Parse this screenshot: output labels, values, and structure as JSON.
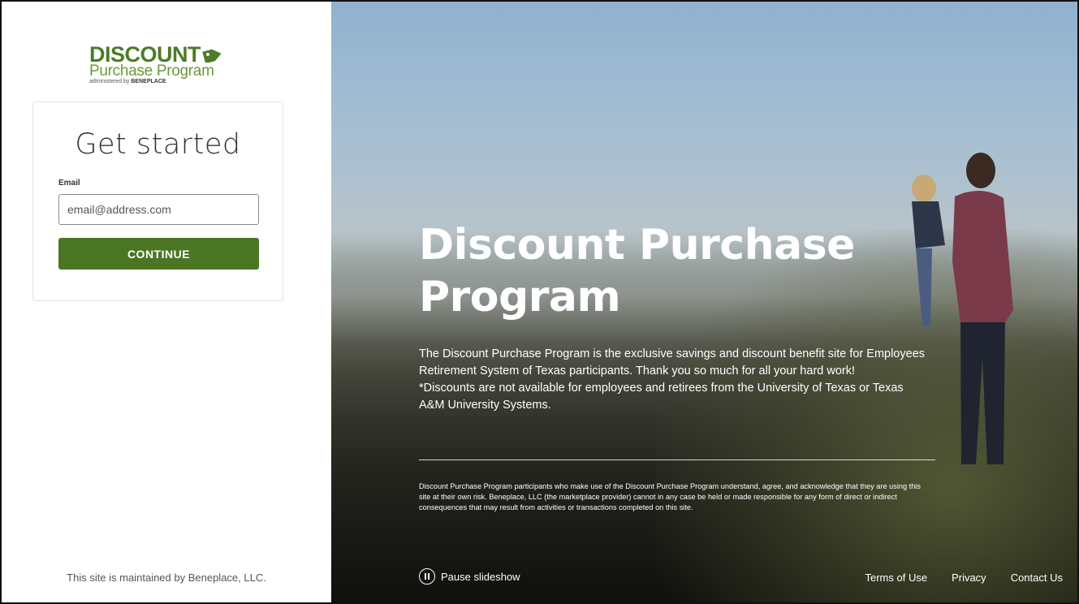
{
  "brand": {
    "logo_line1": "DISCOUNT",
    "logo_line2": "Purchase Program",
    "logo_line3_prefix": "administered by",
    "logo_line3_brand": "BENEPLACE",
    "logo_color": "#4a7d26"
  },
  "signin": {
    "heading": "Get started",
    "email_label": "Email",
    "email_placeholder": "email@address.com",
    "email_value": "",
    "continue_label": "CONTINUE",
    "button_color": "#4b7623"
  },
  "left_footer": {
    "maintained_text": "This site is maintained by Beneplace, LLC."
  },
  "hero": {
    "title_line1": "Discount Purchase",
    "title_line2": "Program",
    "description": "The Discount Purchase Program is the exclusive savings and discount benefit site for Employees Retirement System of Texas participants. Thank you so much for all your hard work!",
    "note": "*Discounts are not available for employees and retirees from the University of Texas or Texas A&M University Systems.",
    "disclaimer": "Discount Purchase Program participants who make use of the Discount Purchase Program understand, agree, and acknowledge that they are using this site at their own risk. Beneplace, LLC (the marketplace provider) cannot in any case be held or made responsible for any form of direct or indirect consequences that may result from activities or transactions completed on this site."
  },
  "slideshow": {
    "pause_label": "Pause slideshow",
    "icon": "pause-circle-icon"
  },
  "footer": {
    "links": [
      "Terms of Use",
      "Privacy",
      "Contact Us"
    ]
  }
}
